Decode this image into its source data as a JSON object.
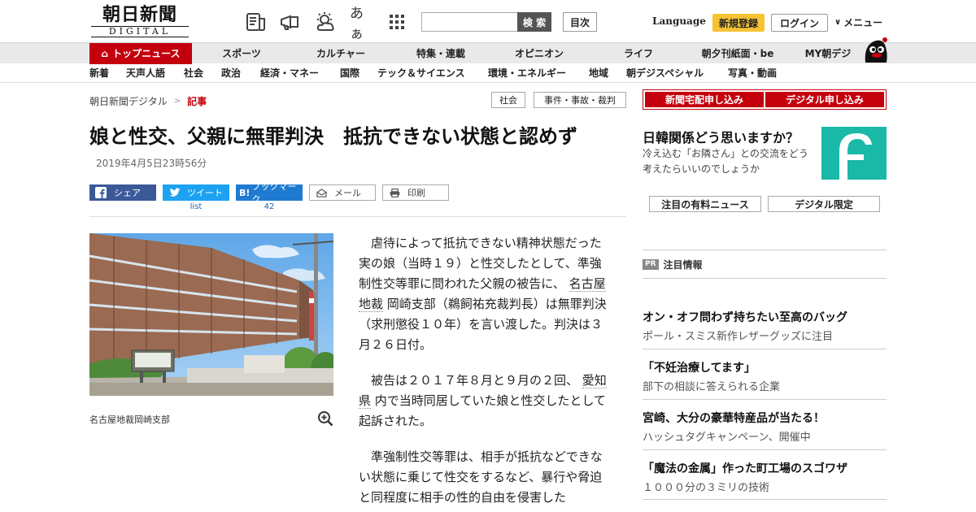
{
  "header": {
    "logo_main": "朝日新聞",
    "logo_sub": "DIGITAL",
    "font_icon_label": "あぁ",
    "search_label": "検 索",
    "toc_label": "目次",
    "language_label": "Language",
    "register_label": "新規登録",
    "login_label": "ログイン",
    "menu_label": "メニュー"
  },
  "nav1": [
    "トップニュース",
    "スポーツ",
    "カルチャー",
    "特集・連載",
    "オピニオン",
    "ライフ",
    "朝夕刊紙面・be",
    "MY朝デジ"
  ],
  "nav2": [
    "新着",
    "天声人語",
    "社会",
    "政治",
    "経済・マネー",
    "国際",
    "テック＆サイエンス",
    "環境・エネルギー",
    "地域",
    "朝デジスペシャル",
    "写真・動画"
  ],
  "breadcrumb": {
    "home": "朝日新聞デジタル",
    "sep": ">",
    "current": "記事"
  },
  "tags": [
    "社会",
    "事件・事故・裁判"
  ],
  "article": {
    "headline": "娘と性交、父親に無罪判決　抵抗できない状態と認めず",
    "timestamp": "2019年4月5日23時56分",
    "share": {
      "facebook": "シェア",
      "twitter": "ツイート",
      "hatena_icon": "B!",
      "hatena": "ブックマーク",
      "mail": "メール",
      "print": "印刷",
      "twitter_count": "list",
      "hatena_count": "42"
    },
    "photo_caption": "名古屋地裁岡崎支部",
    "body": {
      "p1_a": "虐待によって抵抗できない精神状態だった実の娘（当時１９）と性交したとして、準強制性交等罪に問われた父親の被告に、",
      "p1_kw": "名古屋地裁",
      "p1_b": "岡崎支部（鵜飼祐充裁判長）は無罪判決（求刑懲役１０年）を言い渡した。判決は３月２６日付。",
      "p2_a": "被告は２０１７年８月と９月の２回、",
      "p2_kw": "愛知県",
      "p2_b": "内で当時同居していた娘と性交したとして起訴された。",
      "p3": "準強制性交等罪は、相手が抵抗などできない状態に乗じて性交をするなど、暴行や脅迫と同程度に相手の性的自由を侵害した"
    }
  },
  "sidebar": {
    "subscribe_home": "新聞宅配申し込み",
    "subscribe_digital": "デジタル申し込み",
    "question_title": "日韓関係どう思いますか？",
    "question_sub": "冷え込む「お隣さん」との交流をどう考えたらいいのでしょうか",
    "tab_paid": "注目の有料ニュース",
    "tab_digital": "デジタル限定",
    "pr_badge": "PR",
    "pr_head": "注目情報",
    "pr_items": [
      {
        "title": "オン・オフ問わず持ちたい至高のバッグ",
        "sub": "ポール・スミス新作レザーグッズに注目"
      },
      {
        "title": "「不妊治療してます」",
        "sub": "部下の相談に答えられる企業"
      },
      {
        "title": "宮崎、大分の豪華特産品が当たる！",
        "sub": "ハッシュタグキャンペーン、開催中"
      },
      {
        "title": "「魔法の金属」作った町工場のスゴワザ",
        "sub": "１０００分の３ミリの技術"
      }
    ]
  },
  "colors": {
    "brand_red": "#c4000d",
    "register_yellow": "#f7c233",
    "facebook": "#3b5998",
    "twitter": "#1da1f2",
    "hatena": "#1f7bd1",
    "question_teal": "#1ab8a7"
  }
}
